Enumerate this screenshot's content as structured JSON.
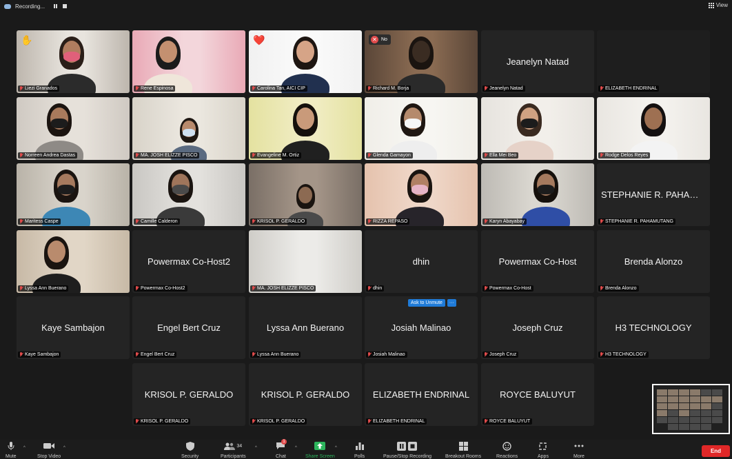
{
  "topbar": {
    "recording_label": "Recording...",
    "view_label": "View"
  },
  "tiles": [
    {
      "id": "liezi",
      "label": "Liezi Granados",
      "big": "",
      "type": "video",
      "reaction": "✋"
    },
    {
      "id": "rene",
      "label": "Rene Espinosa",
      "big": "",
      "type": "video",
      "active": true
    },
    {
      "id": "carolina",
      "label": "Carolina Tan, AICI CIP",
      "big": "",
      "type": "video",
      "reaction": "❤️"
    },
    {
      "id": "richard",
      "label": "Richard M. Borja",
      "big": "",
      "type": "video",
      "no_badge": "No"
    },
    {
      "id": "jeanelyn",
      "label": "Jeanelyn Natad",
      "big": "Jeanelyn Natad",
      "type": "name"
    },
    {
      "id": "elizabeth1",
      "label": "ELIZABETH ENDRINAL",
      "big": "",
      "type": "dark"
    },
    {
      "id": "norreen",
      "label": "Norreen Andrea Dastas",
      "big": "",
      "type": "video"
    },
    {
      "id": "majosh1",
      "label": "MA. JOSH ELIZZE PISCO",
      "big": "",
      "type": "video"
    },
    {
      "id": "evangeline",
      "label": "Evangeline M. Ortiz",
      "big": "",
      "type": "video"
    },
    {
      "id": "glenda",
      "label": "Glenda Gamayon",
      "big": "",
      "type": "video"
    },
    {
      "id": "ella",
      "label": "Ella Mei Beo",
      "big": "",
      "type": "video"
    },
    {
      "id": "rodge",
      "label": "Rodge Delos Reyes",
      "big": "",
      "type": "video"
    },
    {
      "id": "maritess",
      "label": "Maritess Caspe",
      "big": "",
      "type": "video"
    },
    {
      "id": "camille",
      "label": "Camille Calderon",
      "big": "",
      "type": "video"
    },
    {
      "id": "krisol1",
      "label": "KRISOL P. GERALDO",
      "big": "",
      "type": "video"
    },
    {
      "id": "rizza",
      "label": "RIZZA REPASO",
      "big": "",
      "type": "video"
    },
    {
      "id": "karyn",
      "label": "Karyn Abayabay",
      "big": "",
      "type": "video"
    },
    {
      "id": "stephanie",
      "label": "STEPHANIE R. PAHAMUTANG",
      "big": "STEPHANIE R. PAHAMU...",
      "type": "name"
    },
    {
      "id": "lyssa1",
      "label": "Lyssa Ann Buerano",
      "big": "",
      "type": "video"
    },
    {
      "id": "powermax2",
      "label": "Powermax Co-Host2",
      "big": "Powermax Co-Host2",
      "type": "name"
    },
    {
      "id": "majosh2",
      "label": "MA. JOSH ELIZZE PISCO",
      "big": "",
      "type": "video"
    },
    {
      "id": "dhin",
      "label": "dhin",
      "big": "dhin",
      "type": "name"
    },
    {
      "id": "powermax",
      "label": "Powermax Co-Host",
      "big": "Powermax Co-Host",
      "type": "name"
    },
    {
      "id": "brenda",
      "label": "Brenda Alonzo",
      "big": "Brenda Alonzo",
      "type": "name"
    },
    {
      "id": "kaye",
      "label": "Kaye Sambajon",
      "big": "Kaye Sambajon",
      "type": "name"
    },
    {
      "id": "engel",
      "label": "Engel Bert Cruz",
      "big": "Engel Bert Cruz",
      "type": "name"
    },
    {
      "id": "lyssa2",
      "label": "Lyssa Ann Buerano",
      "big": "Lyssa Ann Buerano",
      "type": "name"
    },
    {
      "id": "josiah",
      "label": "Josiah Malinao",
      "big": "Josiah Malinao",
      "type": "name"
    },
    {
      "id": "joseph",
      "label": "Joseph Cruz",
      "big": "Joseph Cruz",
      "type": "name"
    },
    {
      "id": "h3",
      "label": "H3 TECHNOLOGY",
      "big": "H3 TECHNOLOGY",
      "type": "name"
    },
    {
      "id": "krisol2",
      "label": "KRISOL P. GERALDO",
      "big": "KRISOL P. GERALDO",
      "type": "name"
    },
    {
      "id": "krisol3",
      "label": "KRISOL P. GERALDO",
      "big": "KRISOL P. GERALDO",
      "type": "name"
    },
    {
      "id": "elizabeth2",
      "label": "ELIZABETH ENDRINAL",
      "big": "ELIZABETH ENDRINAL",
      "type": "name"
    },
    {
      "id": "royce",
      "label": "ROYCE BALUYUT",
      "big": "ROYCE BALUYUT",
      "type": "name"
    }
  ],
  "hover_controls": {
    "ask_to_unmute": "Ask to Unmute",
    "more": "···"
  },
  "toolbar": {
    "mute": "Mute",
    "stop_video": "Stop Video",
    "security": "Security",
    "participants": "Participants",
    "participants_count": "34",
    "chat": "Chat",
    "chat_badge": "1",
    "share_screen": "Share Screen",
    "polls": "Polls",
    "pause_recording": "Pause/Stop Recording",
    "breakout_rooms": "Breakout Rooms",
    "reactions": "Reactions",
    "apps": "Apps",
    "more": "More",
    "end": "End"
  }
}
